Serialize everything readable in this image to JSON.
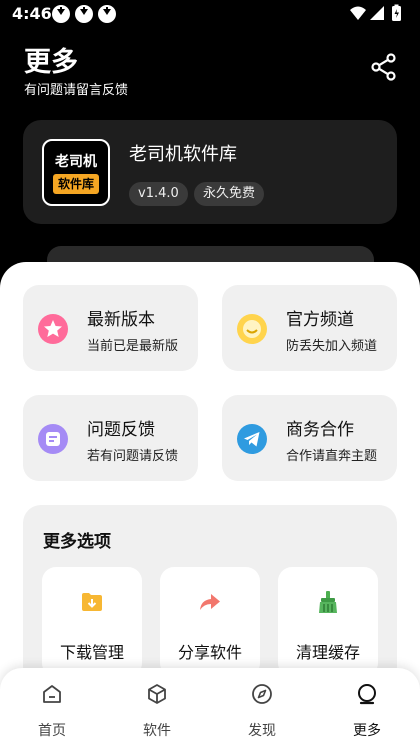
{
  "status_bar": {
    "time": "4:46"
  },
  "header": {
    "title": "更多",
    "subtitle": "有问题请留言反馈",
    "share_icon": "share-icon"
  },
  "app": {
    "logo_line1": "老司机",
    "logo_line2": "软件库",
    "name": "老司机软件库",
    "version": "v1.4.0",
    "license": "永久免费"
  },
  "tiles": [
    {
      "title": "最新版本",
      "subtitle": "当前已是最新版",
      "icon": "star-badge-icon",
      "color": "#ff6b9a"
    },
    {
      "title": "官方频道",
      "subtitle": "防丢失加入频道",
      "icon": "smile-icon",
      "color": "#ffd44d"
    },
    {
      "title": "问题反馈",
      "subtitle": "若有问题请反馈",
      "icon": "feedback-icon",
      "color": "#a58bf5"
    },
    {
      "title": "商务合作",
      "subtitle": "合作请直奔主题",
      "icon": "telegram-icon",
      "color": "#2f9be0"
    }
  ],
  "more": {
    "title": "更多选项",
    "options": [
      {
        "label": "下载管理",
        "icon": "download-folder-icon"
      },
      {
        "label": "分享软件",
        "icon": "share-arrow-icon"
      },
      {
        "label": "清理缓存",
        "icon": "broom-icon"
      }
    ]
  },
  "nav": {
    "items": [
      {
        "label": "首页",
        "icon": "home-icon"
      },
      {
        "label": "软件",
        "icon": "box-icon"
      },
      {
        "label": "发现",
        "icon": "compass-icon"
      },
      {
        "label": "更多",
        "icon": "more-icon",
        "active": true
      }
    ]
  }
}
